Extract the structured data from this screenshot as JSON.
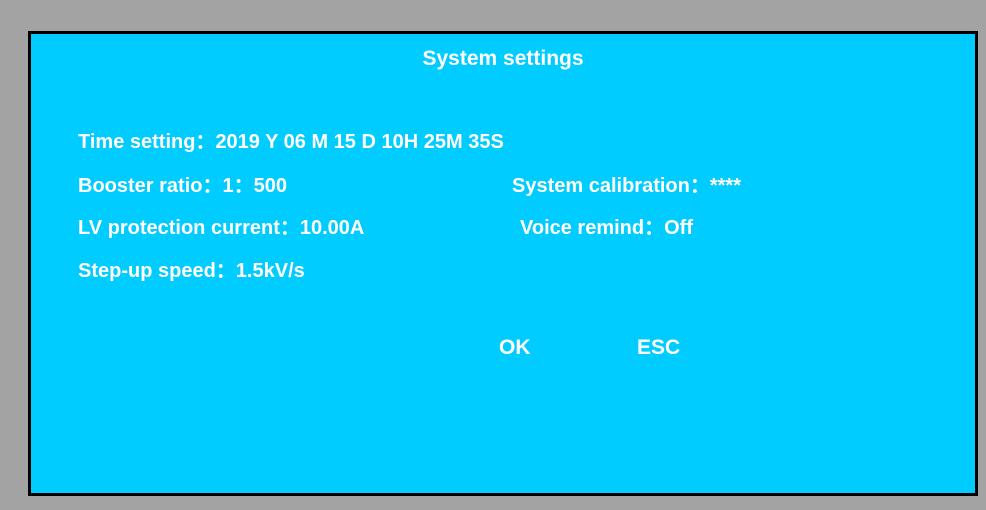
{
  "dialog": {
    "title": "System settings"
  },
  "settings": {
    "time": {
      "label": "Time setting：",
      "value": "2019 Y 06 M 15 D 10H 25M 35S"
    },
    "booster_ratio": {
      "label": "Booster ratio：",
      "value": "1：500"
    },
    "system_calibration": {
      "label": "System calibration：",
      "value": "****"
    },
    "lv_protection_current": {
      "label": "LV protection current：",
      "value": "10.00A"
    },
    "voice_remind": {
      "label": "Voice remind：",
      "value": "Off"
    },
    "step_up_speed": {
      "label": "Step-up speed：",
      "value": "1.5kV/s"
    }
  },
  "buttons": {
    "ok": "OK",
    "esc": "ESC"
  },
  "colors": {
    "panel_background": "#00ccff",
    "text": "#ffffff",
    "outer_frame": "#a3a3a3",
    "border": "#000000"
  }
}
